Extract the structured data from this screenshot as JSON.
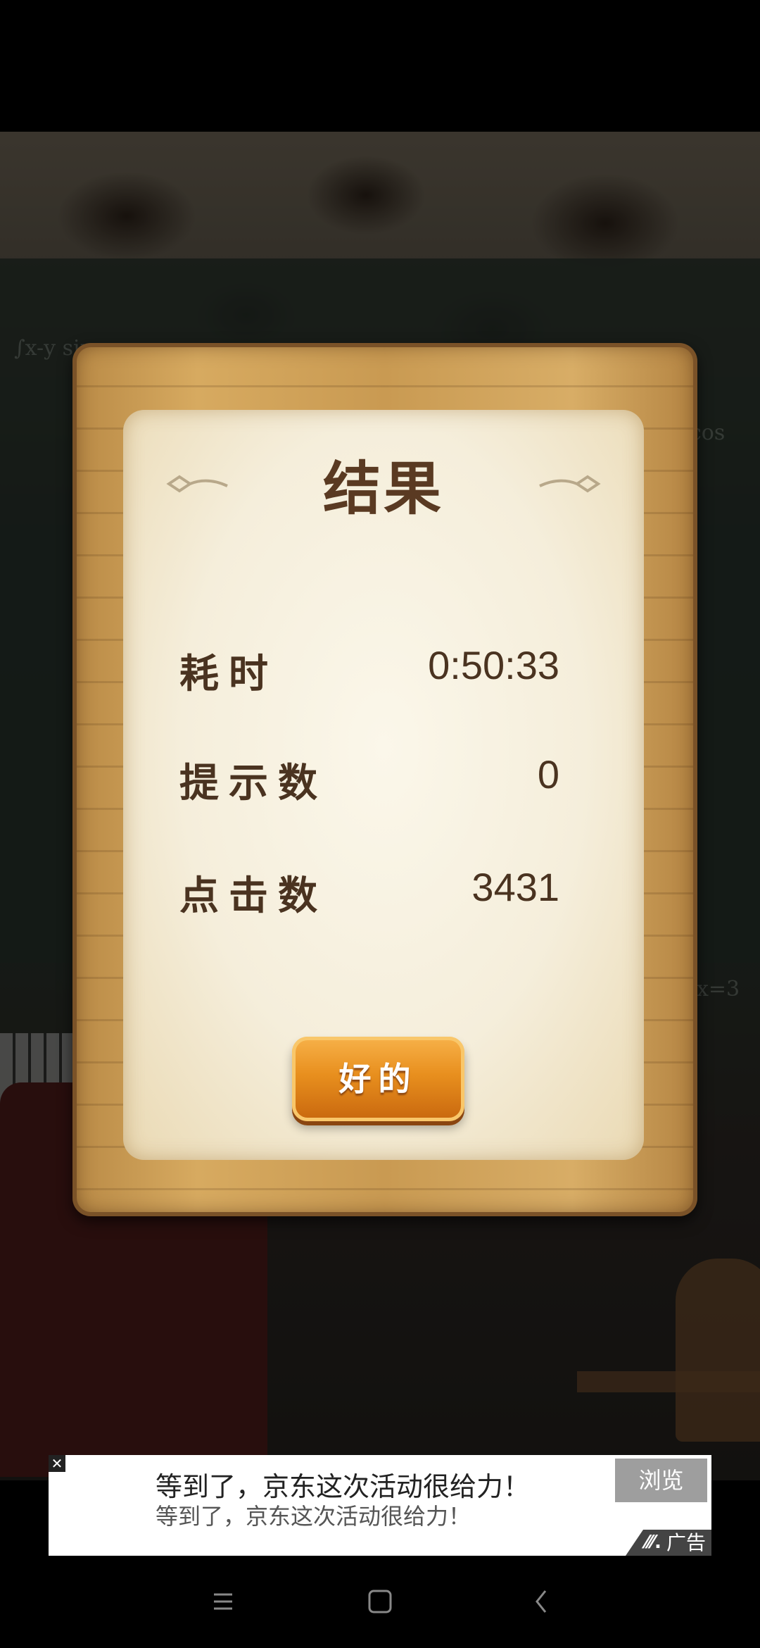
{
  "result": {
    "title": "结果",
    "rows": [
      {
        "label": "耗时",
        "value": "0:50:33"
      },
      {
        "label": "提示数",
        "value": "0"
      },
      {
        "label": "点击数",
        "value": "3431"
      }
    ],
    "ok_label": "好的"
  },
  "ad": {
    "headline": "等到了，京东这次活动很给力！",
    "subline": "等到了，京东这次活动很给力！",
    "browse_label": "浏览",
    "tag_label": "广告",
    "close_glyph": "✕"
  },
  "navbar": {
    "icons": [
      "menu-icon",
      "home-square-icon",
      "back-icon"
    ]
  },
  "colors": {
    "paper": "#f5eedb",
    "wood": "#c99a52",
    "button": "#e88f1e",
    "text_dark": "#4a3320"
  }
}
